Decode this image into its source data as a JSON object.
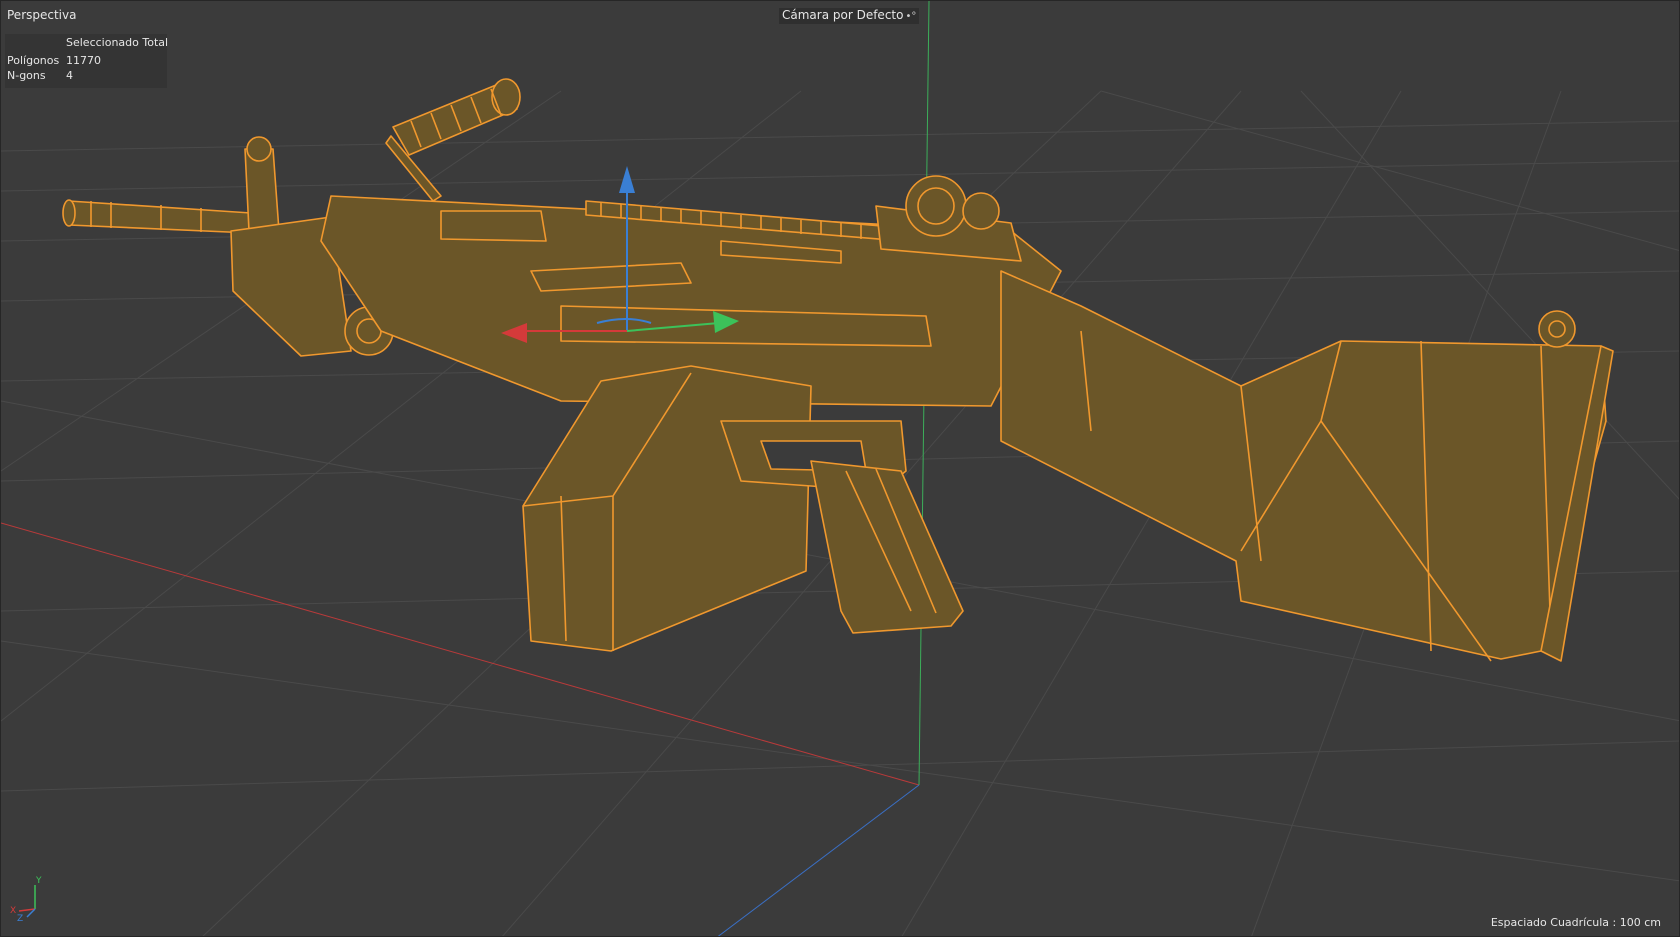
{
  "viewport": {
    "view_name": "Perspectiva",
    "camera": "Cámara por Defecto",
    "camera_icon": "camera-options-icon",
    "grid_spacing": "Espaciado Cuadrícula : 100 cm"
  },
  "stats": {
    "column_header": "Seleccionado Total",
    "rows": [
      {
        "label": "Polígonos",
        "value": "11770"
      },
      {
        "label": "N-gons",
        "value": "4"
      }
    ]
  },
  "axis_widget": {
    "x": "X",
    "y": "Y",
    "z": "Z"
  },
  "colors": {
    "background": "#3b3b3b",
    "grid": "#4a4a4a",
    "model_fill": "#6b5628",
    "model_wire": "#f0982e",
    "x_axis": "#d43a3a",
    "y_axis": "#3cc25a",
    "z_axis": "#3a7fd4"
  }
}
